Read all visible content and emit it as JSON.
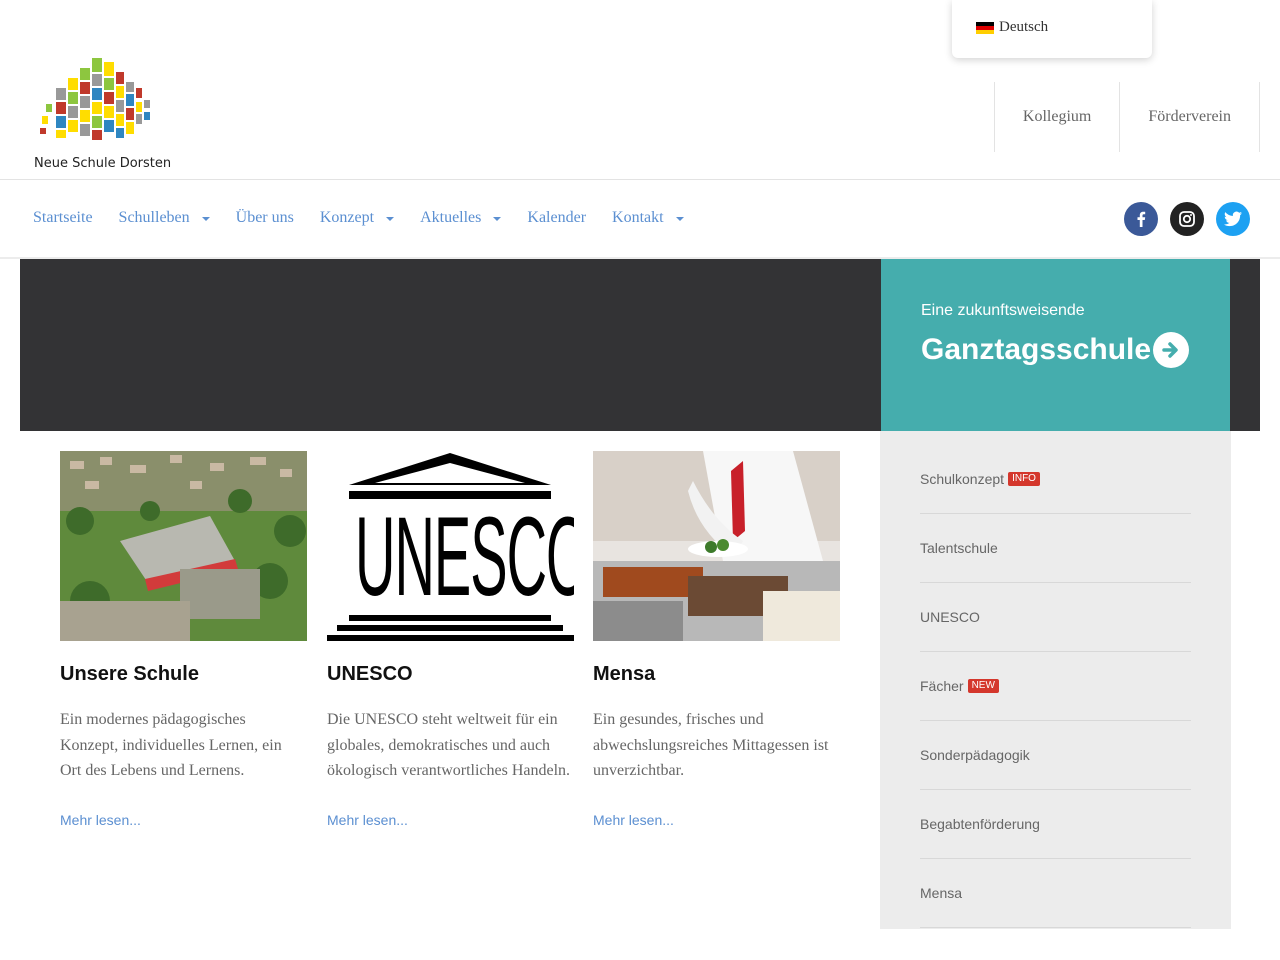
{
  "language": {
    "label": "Deutsch",
    "flag_colors": [
      "#000000",
      "#dd0000",
      "#ffce00"
    ]
  },
  "logo": {
    "text": "Neue Schule Dorsten"
  },
  "top_links": [
    {
      "label": "Kollegium"
    },
    {
      "label": "Förderverein"
    }
  ],
  "nav": {
    "items": [
      {
        "label": "Startseite"
      },
      {
        "label": "Schulleben"
      },
      {
        "label": "Über uns"
      },
      {
        "label": "Konzept"
      },
      {
        "label": "Aktuelles"
      },
      {
        "label": "Kalender"
      },
      {
        "label": "Kontakt"
      }
    ]
  },
  "social": [
    {
      "icon": "facebook-icon",
      "color": "#3b5998"
    },
    {
      "icon": "instagram-icon",
      "color": "#222222"
    },
    {
      "icon": "twitter-icon",
      "color": "#1da1f2"
    }
  ],
  "hero": {
    "subtitle": "Eine zukunftsweisende",
    "title": "Ganztagsschule",
    "panel_color": "#45adad"
  },
  "cards": [
    {
      "title": "Unsere Schule",
      "text": "Ein modernes pädagogisches Konzept, individuelles Lernen, ein Ort des Lebens und Lernens.",
      "link": "Mehr lesen..."
    },
    {
      "title": "UNESCO",
      "text": "Die UNESCO steht weltweit für ein globales, demokratisches und auch ökologisch verantwortliches Handeln.",
      "link": "Mehr lesen...",
      "logo_text": "UNESCO"
    },
    {
      "title": "Mensa",
      "text": "Ein gesundes, frisches und abwechslungsreiches Mittagessen ist unverzichtbar.",
      "link": "Mehr lesen..."
    }
  ],
  "sidebar": {
    "items": [
      {
        "label": "Schulkonzept",
        "badge": "INFO"
      },
      {
        "label": "Talentschule"
      },
      {
        "label": "UNESCO"
      },
      {
        "label": "Fächer",
        "badge": "NEW"
      },
      {
        "label": "Sonderpädagogik"
      },
      {
        "label": "Begabtenförderung"
      },
      {
        "label": "Mensa"
      }
    ]
  }
}
